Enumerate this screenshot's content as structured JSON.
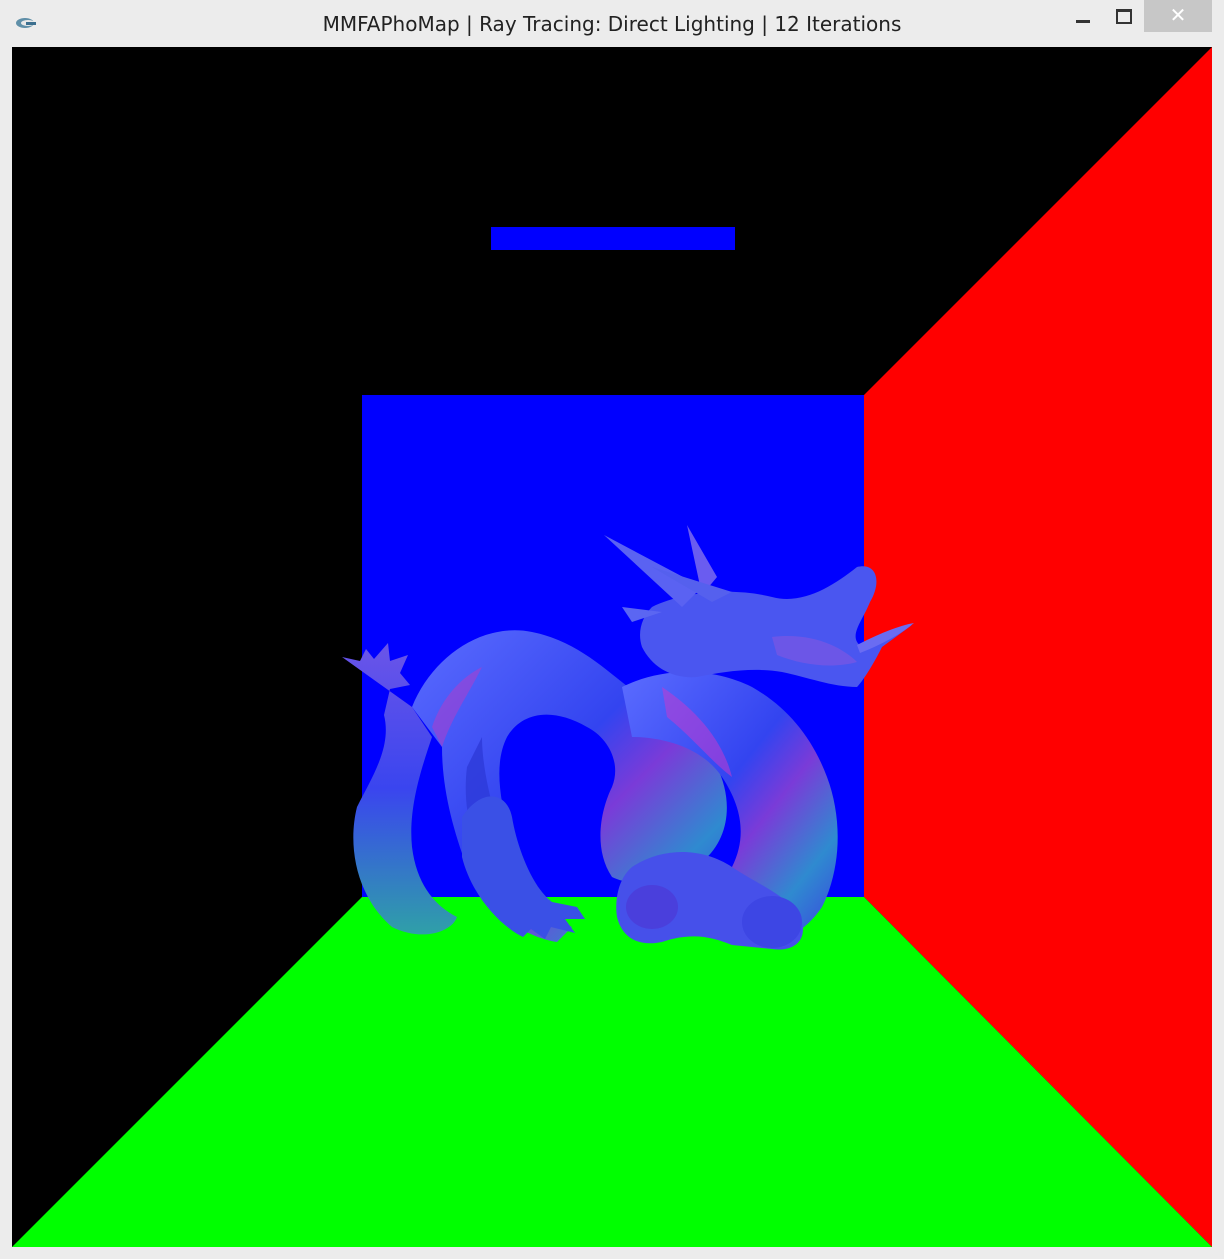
{
  "window": {
    "title": "MMFAPhoMap | Ray Tracing: Direct Lighting | 12 Iterations",
    "controls": {
      "minimize_icon": "minimize-icon",
      "maximize_icon": "maximize-icon",
      "close_glyph": "✕"
    }
  },
  "scene": {
    "description_icon": "rendered-cornell-box",
    "colors": {
      "left_wall": "#000000",
      "ceiling": "#000000",
      "right_wall": "#ff0000",
      "floor": "#00ff00",
      "back_wall": "#0000ff",
      "light": "#0000ff",
      "dragon": "#3a4cf0"
    }
  }
}
